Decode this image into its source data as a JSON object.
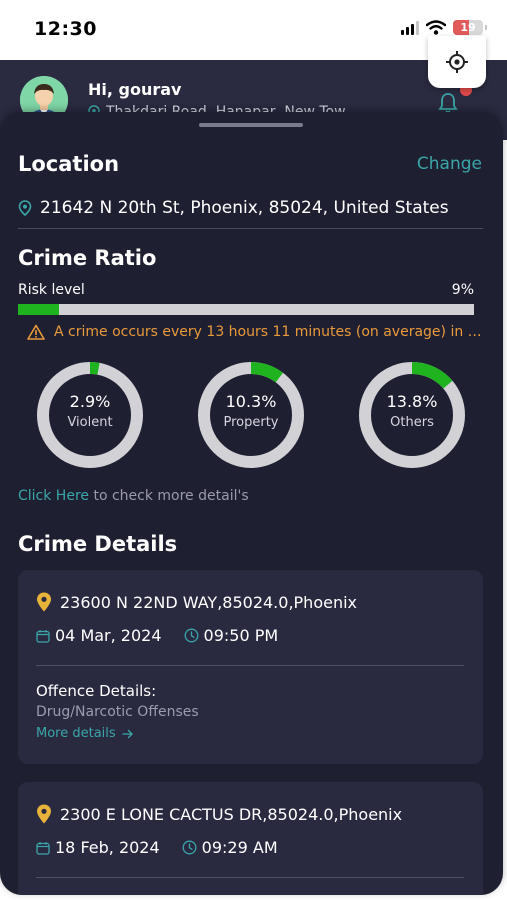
{
  "status_bar": {
    "time": "12:30",
    "battery": "19"
  },
  "header": {
    "greeting": "Hi, gourav",
    "address": "Thakdari Road, Hanapar, New Tow..."
  },
  "location": {
    "title": "Location",
    "change_label": "Change",
    "address": "21642 N 20th St, Phoenix, 85024, United States"
  },
  "crime_ratio": {
    "title": "Crime Ratio",
    "risk_label": "Risk level",
    "risk_value": "9%",
    "risk_fraction": 0.09,
    "warning": "A crime occurs every 13 hours 11 minutes (on average) in 8...",
    "donuts": [
      {
        "value": "2.9%",
        "label": "Violent",
        "fraction": 0.029
      },
      {
        "value": "10.3%",
        "label": "Property",
        "fraction": 0.103
      },
      {
        "value": "13.8%",
        "label": "Others",
        "fraction": 0.138
      }
    ],
    "more_detail_link": "Click Here",
    "more_detail_text": " to check more detail's"
  },
  "crime_details": {
    "title": "Crime Details",
    "items": [
      {
        "address": "23600 N 22ND WAY,85024.0,Phoenix",
        "date": "04 Mar, 2024",
        "time": "09:50 PM",
        "offence_title": "Offence Details:",
        "offence_type": "Drug/Narcotic Offenses",
        "more_label": "More details"
      },
      {
        "address": "2300 E LONE CACTUS DR,85024.0,Phoenix",
        "date": "18 Feb, 2024",
        "time": "09:29 AM"
      }
    ]
  },
  "colors": {
    "accent": "#3aa6a8",
    "risk_fill": "#1fb31f",
    "donut_fill": "#1fb31f",
    "donut_track": "#d1d1d6",
    "warning": "#e99a3a",
    "sheet_bg": "#1f1f32",
    "card_bg": "#292940"
  },
  "icons": {
    "locate": "crosshair-icon",
    "notifications": "bell-icon",
    "location_pin": "map-pin-icon",
    "warning": "warning-triangle-icon",
    "calendar": "calendar-icon",
    "clock": "clock-icon"
  }
}
